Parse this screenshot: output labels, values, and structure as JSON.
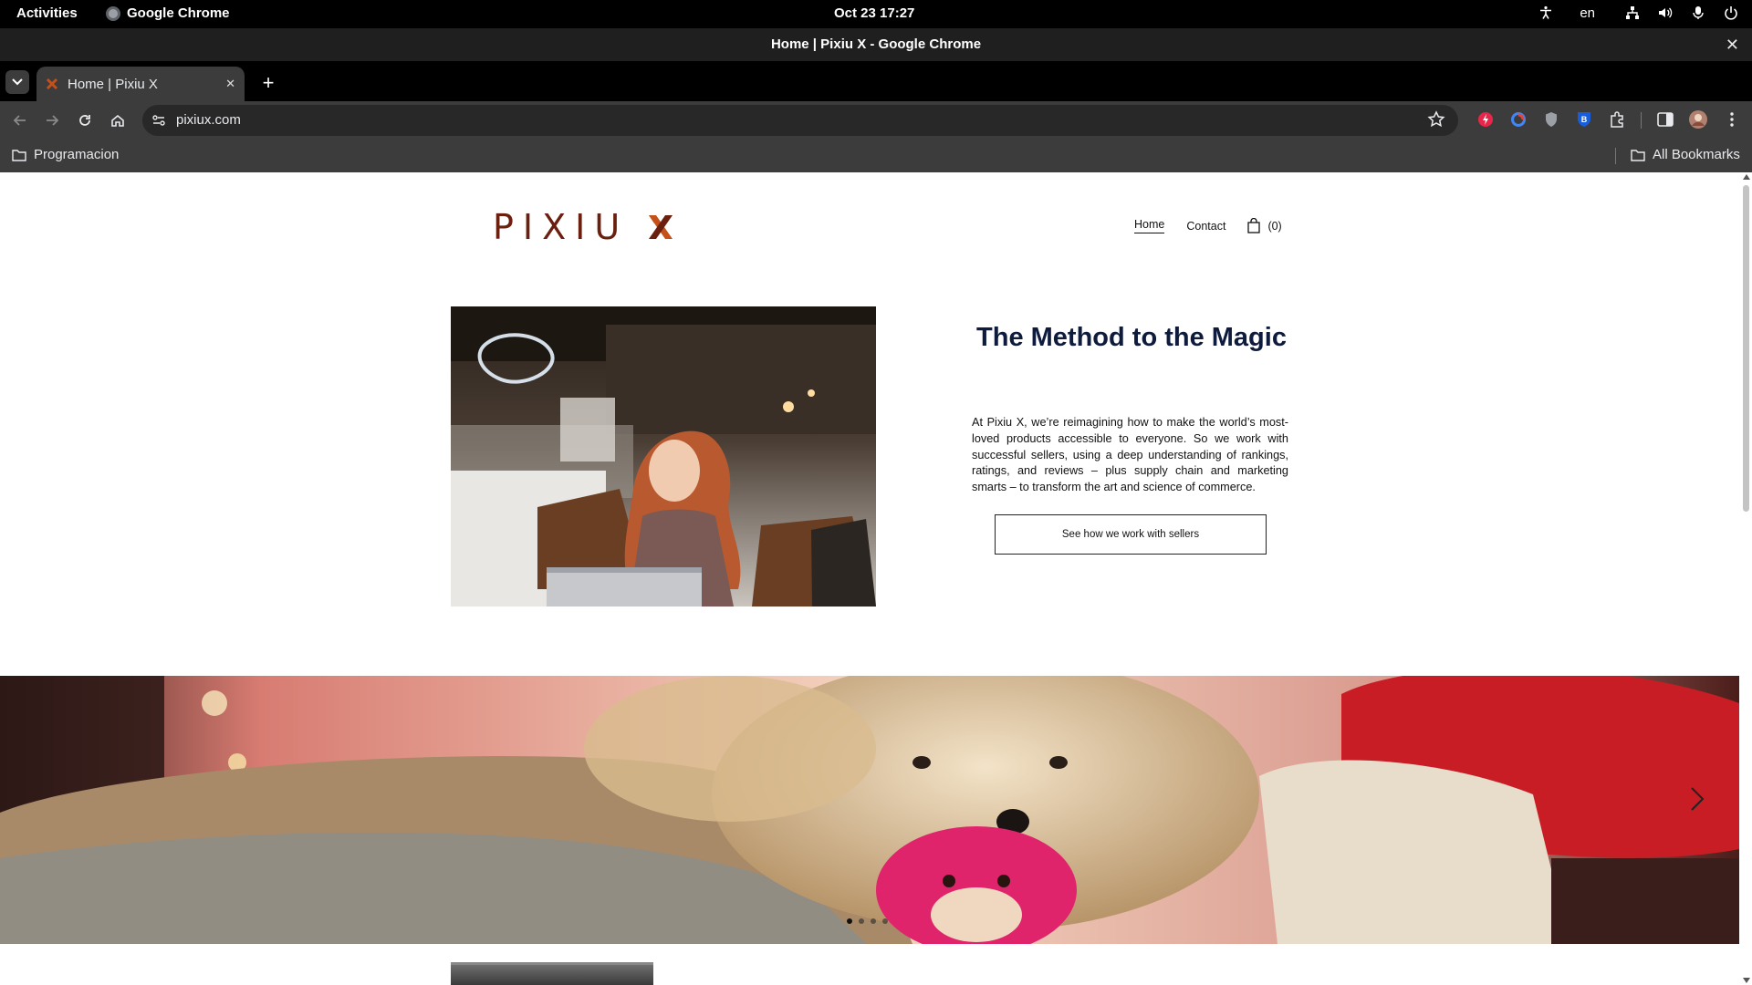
{
  "system_bar": {
    "activities": "Activities",
    "app_name": "Google Chrome",
    "datetime": "Oct 23  17:27",
    "language": "en",
    "icons": [
      "accessibility-icon",
      "network-icon",
      "volume-icon",
      "microphone-icon",
      "power-icon"
    ]
  },
  "window": {
    "title": "Home | Pixiu X - Google Chrome"
  },
  "tabs": [
    {
      "title": "Home | Pixiu X",
      "active": true
    }
  ],
  "toolbar": {
    "url": "pixiux.com"
  },
  "bookmarks_bar": {
    "left": "Programacion",
    "right": "All Bookmarks"
  },
  "site": {
    "logo_text": "PIXIU",
    "brand_color": "#c4501a",
    "nav": [
      {
        "label": "Home",
        "active": true
      },
      {
        "label": "Contact",
        "active": false
      }
    ],
    "cart_count": "(0)",
    "hero": {
      "title": "The Method to the Magic",
      "body": "At Pixiu X, we’re reimagining how to make the world’s most-loved products accessible to everyone. So we work with successful sellers, using a deep understanding of rankings, ratings, and reviews – plus supply chain and marketing smarts – to transform the art and science of commerce.",
      "button": "See how we work with sellers"
    },
    "slider": {
      "dots": 4,
      "active_dot": 1
    }
  }
}
